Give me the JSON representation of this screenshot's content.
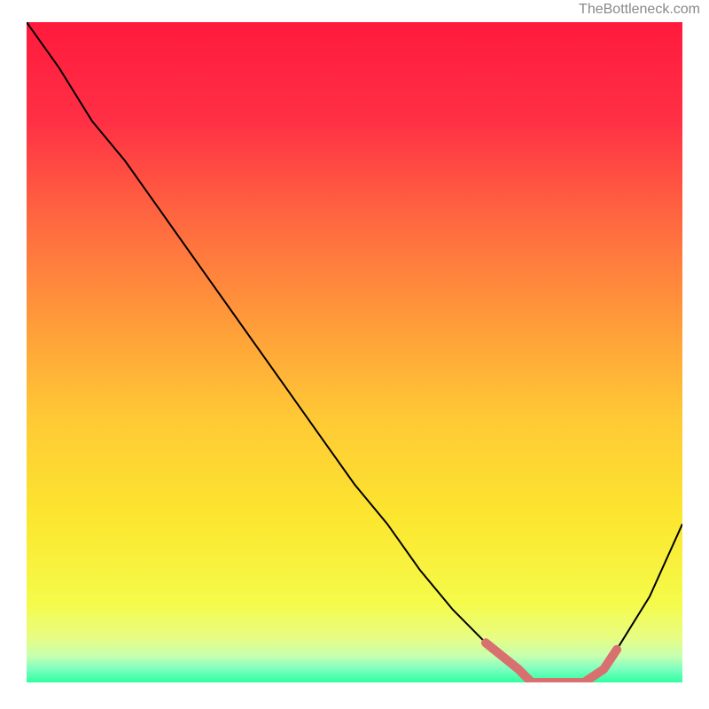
{
  "watermark": "TheBottleneck.com",
  "chart_data": {
    "type": "line",
    "title": "",
    "xlabel": "",
    "ylabel": "",
    "x": [
      0,
      5,
      10,
      15,
      20,
      25,
      30,
      35,
      40,
      45,
      50,
      55,
      60,
      65,
      70,
      75,
      77,
      80,
      82,
      85,
      88,
      90,
      95,
      100
    ],
    "y": [
      100,
      93,
      85,
      79,
      72,
      65,
      58,
      51,
      44,
      37,
      30,
      24,
      17,
      11,
      6,
      2,
      0,
      0,
      0,
      0,
      2,
      5,
      13,
      24
    ],
    "xlim": [
      0,
      100
    ],
    "ylim": [
      0,
      100
    ],
    "gradient_stops": [
      {
        "offset": 0,
        "color": "#ff1a3d"
      },
      {
        "offset": 0.15,
        "color": "#ff3045"
      },
      {
        "offset": 0.3,
        "color": "#ff6840"
      },
      {
        "offset": 0.45,
        "color": "#ff9a3a"
      },
      {
        "offset": 0.6,
        "color": "#ffc935"
      },
      {
        "offset": 0.75,
        "color": "#fce62f"
      },
      {
        "offset": 0.88,
        "color": "#f5fb4a"
      },
      {
        "offset": 0.93,
        "color": "#e9fd80"
      },
      {
        "offset": 0.96,
        "color": "#c8ffb0"
      },
      {
        "offset": 0.98,
        "color": "#7cffc0"
      },
      {
        "offset": 1.0,
        "color": "#2effa0"
      }
    ],
    "marker_region": {
      "x_start": 70,
      "x_end": 90,
      "color": "#d87070"
    }
  }
}
